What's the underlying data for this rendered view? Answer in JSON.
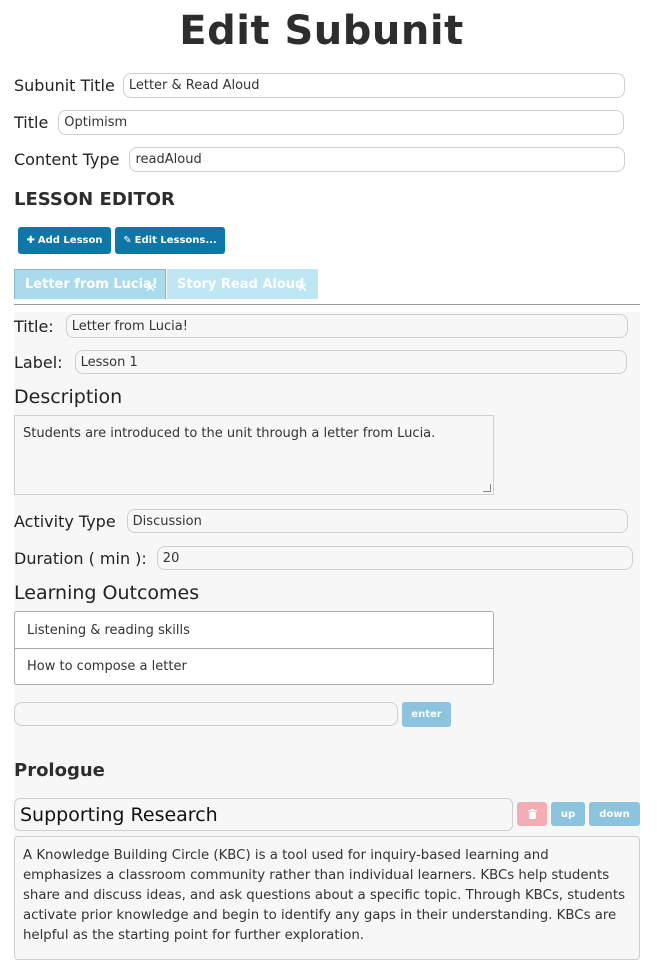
{
  "page_title": "Edit Subunit",
  "subunit": {
    "subunit_title_label": "Subunit Title",
    "subunit_title_value": "Letter & Read Aloud",
    "title_label": "Title",
    "title_value": "Optimism",
    "content_type_label": "Content Type",
    "content_type_value": "readAloud"
  },
  "lesson_editor": {
    "heading": "LESSON EDITOR",
    "add_lesson_label": "Add Lesson",
    "edit_lessons_label": "Edit Lessons...",
    "tabs": [
      {
        "label": "Letter from Lucia!",
        "active": true
      },
      {
        "label": "Story Read Aloud",
        "active": false
      }
    ]
  },
  "lesson": {
    "title_label": "Title:",
    "title_value": "Letter from Lucia!",
    "label_label": "Label:",
    "label_value": "Lesson 1",
    "description_heading": "Description",
    "description_value": "Students are introduced to the unit through a letter from Lucia.",
    "activity_type_label": "Activity Type",
    "activity_type_value": "Discussion",
    "duration_label": "Duration ( min ):",
    "duration_value": "20",
    "outcomes_heading": "Learning Outcomes",
    "outcomes": [
      "Listening & reading skills",
      "How to compose a letter"
    ],
    "new_outcome_value": "",
    "enter_label": "enter"
  },
  "prologue": {
    "heading": "Prologue",
    "research_title": "Supporting Research",
    "up_label": "up",
    "down_label": "down",
    "research_text": "A Knowledge Building Circle (KBC) is a tool used for inquiry-based learning and emphasizes a classroom community rather than individual learners. KBCs help students share and discuss ideas, and ask questions about a specific topic. Through KBCs, students activate prior knowledge and begin to identify any gaps in their understanding. KBCs are helpful as the starting point for further exploration."
  },
  "colors": {
    "primary_button": "#0f76a8",
    "light_button": "#8cc3df",
    "delete_button": "#f2aeb4",
    "tab_active": "#a9dbec",
    "tab_inactive": "#bfe7f3"
  },
  "icons": {
    "add": "plus-icon",
    "edit": "edit-icon",
    "tab_close": "close-icon",
    "delete": "trash-icon"
  }
}
